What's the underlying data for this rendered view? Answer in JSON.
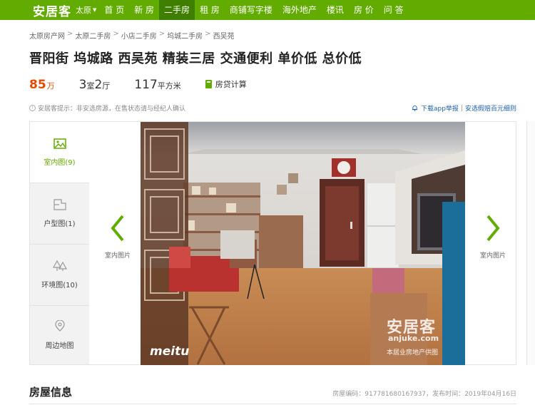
{
  "nav": {
    "logo": "安居客",
    "city": "太原",
    "items": [
      {
        "label": "首 页"
      },
      {
        "label": "新 房"
      },
      {
        "label": "二手房",
        "active": true
      },
      {
        "label": "租 房"
      },
      {
        "label": "商铺写字楼"
      },
      {
        "label": "海外地产"
      },
      {
        "label": "楼讯"
      },
      {
        "label": "房 价"
      },
      {
        "label": "问 答"
      }
    ]
  },
  "breadcrumb": [
    "太原房产网",
    "太原二手房",
    "小店二手房",
    "坞城二手房",
    "西吴苑"
  ],
  "breadcrumb_sep": ">",
  "title": "晋阳街 坞城路 西吴苑 精装三居 交通便利 单价低 总价低",
  "stats": {
    "price": "85",
    "price_unit": "万",
    "rooms": "3",
    "rooms_unit": "室",
    "halls": "2",
    "halls_unit": "厅",
    "area": "117",
    "area_unit": "平方米",
    "calc_label": "房贷计算"
  },
  "tip": {
    "text": "安居客提示：非安选房源，在售状态请与经纪人确认",
    "report_app": "下载app举报",
    "report_div": "|",
    "report_reward": "安选假赔百元细则"
  },
  "gallery": {
    "tabs": [
      {
        "label": "室内图",
        "count": "(9)",
        "icon": "image-icon",
        "active": true
      },
      {
        "label": "户型图",
        "count": "(1)",
        "icon": "floorplan-icon"
      },
      {
        "label": "环境图",
        "count": "(10)",
        "icon": "trees-icon"
      },
      {
        "label": "周边地图",
        "count": "",
        "icon": "map-pin-icon"
      }
    ],
    "prev_label": "室内图片",
    "next_label": "室内图片",
    "watermark_brand": "安居客",
    "watermark_url": "anjuke.com",
    "watermark_meitu": "meitu",
    "watermark_agency": "本居业房地产供图"
  },
  "section": {
    "title": "房屋信息",
    "code_label": "房屋编码：",
    "code": "917781680167937",
    "date_label": "，发布时间：",
    "date": "2019年04月16日"
  },
  "colors": {
    "brand": "#62ab00",
    "brand_dark": "#3e7f00",
    "price": "#e54b00",
    "link": "#1f5fa8"
  }
}
